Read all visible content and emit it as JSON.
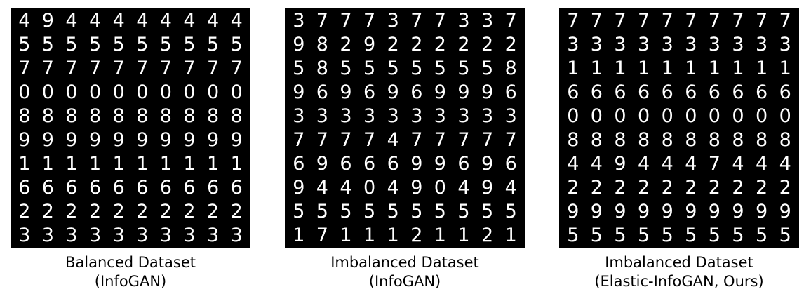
{
  "figure": {
    "panels": [
      {
        "caption_line1": "Balanced Dataset",
        "caption_line2": "(InfoGAN)",
        "rows": [
          "4944444444",
          "5555555555",
          "7777777777",
          "0000000000",
          "8888888888",
          "9999999999",
          "1111111111",
          "6666666666",
          "2222222222",
          "3333333333"
        ]
      },
      {
        "caption_line1": "Imbalanced Dataset",
        "caption_line2": "(InfoGAN)",
        "rows": [
          "3777377337",
          "9829222222",
          "5855555558",
          "9696969996",
          "3333333333",
          "7777477777",
          "6966699696",
          "9440490494",
          "5555555555",
          "1711121121"
        ]
      },
      {
        "caption_line1": "Imbalanced Dataset",
        "caption_line2": "(Elastic-InfoGAN, Ours)",
        "rows": [
          "7777777777",
          "3333333333",
          "1111111111",
          "6666666666",
          "0000000000",
          "8888888888",
          "4494447444",
          "2222222222",
          "9999999999",
          "5555555555"
        ]
      }
    ]
  }
}
